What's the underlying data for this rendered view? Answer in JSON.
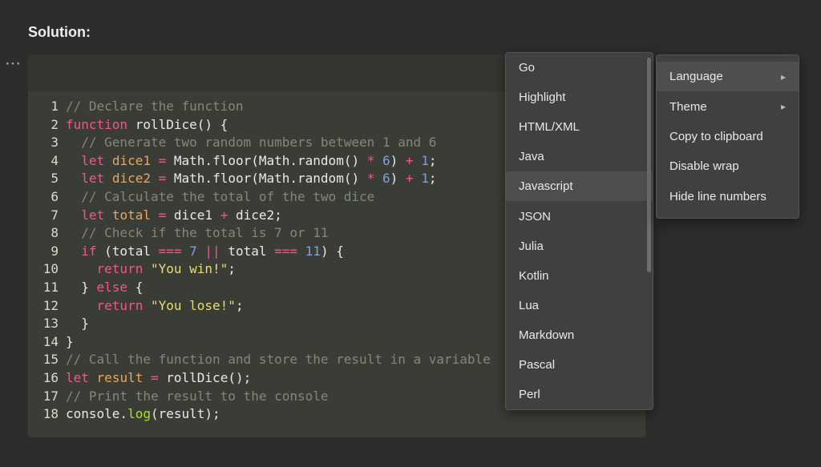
{
  "page": {
    "title": "Solution:"
  },
  "icons": {
    "more_options": "···",
    "submenu_arrow": "▸"
  },
  "colors": {
    "page-bg": "#2d2d2d",
    "code-bg": "#3a3d35",
    "code-header-bg": "#33362e",
    "line-number": "#d8dbd2",
    "tok-plain": "#e9e9e4",
    "tok-comment": "#83877b",
    "tok-keyword": "#f2568e",
    "tok-operator": "#f2568e",
    "tok-variable": "#eda45c",
    "tok-number": "#7e9fe0",
    "tok-string": "#e6db74",
    "tok-function": "#a6e22e",
    "menu-bg": "#404040",
    "menu-selected": "#4e4e4e",
    "menu-text": "#e9e9e9"
  },
  "code_block": {
    "language": "Javascript",
    "lines": [
      {
        "n": "1",
        "tokens": [
          [
            "c",
            "// Declare the function"
          ]
        ]
      },
      {
        "n": "2",
        "tokens": [
          [
            "k",
            "function"
          ],
          [
            "p",
            " rollDice() {"
          ]
        ]
      },
      {
        "n": "3",
        "tokens": [
          [
            "c",
            "  // Generate two random numbers between 1 and 6"
          ]
        ]
      },
      {
        "n": "4",
        "tokens": [
          [
            "p",
            "  "
          ],
          [
            "k",
            "let"
          ],
          [
            "p",
            " "
          ],
          [
            "v",
            "dice1"
          ],
          [
            "p",
            " "
          ],
          [
            "o",
            "="
          ],
          [
            "p",
            " Math.floor(Math.random() "
          ],
          [
            "o",
            "*"
          ],
          [
            "p",
            " "
          ],
          [
            "num",
            "6"
          ],
          [
            "p",
            ") "
          ],
          [
            "o",
            "+"
          ],
          [
            "p",
            " "
          ],
          [
            "num",
            "1"
          ],
          [
            "p",
            ";"
          ]
        ]
      },
      {
        "n": "5",
        "tokens": [
          [
            "p",
            "  "
          ],
          [
            "k",
            "let"
          ],
          [
            "p",
            " "
          ],
          [
            "v",
            "dice2"
          ],
          [
            "p",
            " "
          ],
          [
            "o",
            "="
          ],
          [
            "p",
            " Math.floor(Math.random() "
          ],
          [
            "o",
            "*"
          ],
          [
            "p",
            " "
          ],
          [
            "num",
            "6"
          ],
          [
            "p",
            ") "
          ],
          [
            "o",
            "+"
          ],
          [
            "p",
            " "
          ],
          [
            "num",
            "1"
          ],
          [
            "p",
            ";"
          ]
        ]
      },
      {
        "n": "6",
        "tokens": [
          [
            "c",
            "  // Calculate the total of the two dice"
          ]
        ]
      },
      {
        "n": "7",
        "tokens": [
          [
            "p",
            "  "
          ],
          [
            "k",
            "let"
          ],
          [
            "p",
            " "
          ],
          [
            "v",
            "total"
          ],
          [
            "p",
            " "
          ],
          [
            "o",
            "="
          ],
          [
            "p",
            " dice1 "
          ],
          [
            "o",
            "+"
          ],
          [
            "p",
            " dice2;"
          ]
        ]
      },
      {
        "n": "8",
        "tokens": [
          [
            "c",
            "  // Check if the total is 7 or 11"
          ]
        ]
      },
      {
        "n": "9",
        "tokens": [
          [
            "p",
            "  "
          ],
          [
            "k",
            "if"
          ],
          [
            "p",
            " (total "
          ],
          [
            "o",
            "==="
          ],
          [
            "p",
            " "
          ],
          [
            "num",
            "7"
          ],
          [
            "p",
            " "
          ],
          [
            "o",
            "||"
          ],
          [
            "p",
            " total "
          ],
          [
            "o",
            "==="
          ],
          [
            "p",
            " "
          ],
          [
            "num",
            "11"
          ],
          [
            "p",
            ") {"
          ]
        ]
      },
      {
        "n": "10",
        "tokens": [
          [
            "p",
            "    "
          ],
          [
            "k",
            "return"
          ],
          [
            "p",
            " "
          ],
          [
            "s",
            "\"You win!\""
          ],
          [
            "p",
            ";"
          ]
        ]
      },
      {
        "n": "11",
        "tokens": [
          [
            "p",
            "  } "
          ],
          [
            "k",
            "else"
          ],
          [
            "p",
            " {"
          ]
        ]
      },
      {
        "n": "12",
        "tokens": [
          [
            "p",
            "    "
          ],
          [
            "k",
            "return"
          ],
          [
            "p",
            " "
          ],
          [
            "s",
            "\"You lose!\""
          ],
          [
            "p",
            ";"
          ]
        ]
      },
      {
        "n": "13",
        "tokens": [
          [
            "p",
            "  }"
          ]
        ]
      },
      {
        "n": "14",
        "tokens": [
          [
            "p",
            "}"
          ]
        ]
      },
      {
        "n": "15",
        "tokens": [
          [
            "c",
            "// Call the function and store the result in a variable"
          ]
        ]
      },
      {
        "n": "16",
        "tokens": [
          [
            "k",
            "let"
          ],
          [
            "p",
            " "
          ],
          [
            "v",
            "result"
          ],
          [
            "p",
            " "
          ],
          [
            "o",
            "="
          ],
          [
            "p",
            " rollDice();"
          ]
        ]
      },
      {
        "n": "17",
        "tokens": [
          [
            "c",
            "// Print the result to the console"
          ]
        ]
      },
      {
        "n": "18",
        "tokens": [
          [
            "p",
            "console."
          ],
          [
            "f",
            "log"
          ],
          [
            "p",
            "(result);"
          ]
        ]
      }
    ]
  },
  "language_menu": {
    "items": [
      {
        "label": "Go"
      },
      {
        "label": "Highlight"
      },
      {
        "label": "HTML/XML"
      },
      {
        "label": "Java"
      },
      {
        "label": "Javascript",
        "selected": true
      },
      {
        "label": "JSON"
      },
      {
        "label": "Julia"
      },
      {
        "label": "Kotlin"
      },
      {
        "label": "Lua"
      },
      {
        "label": "Markdown"
      },
      {
        "label": "Pascal"
      },
      {
        "label": "Perl"
      }
    ]
  },
  "options_menu": {
    "items": [
      {
        "label": "Language",
        "selected": true,
        "submenu": true
      },
      {
        "label": "Theme",
        "submenu": true
      },
      {
        "label": "Copy to clipboard"
      },
      {
        "label": "Disable wrap"
      },
      {
        "label": "Hide line numbers"
      }
    ]
  }
}
